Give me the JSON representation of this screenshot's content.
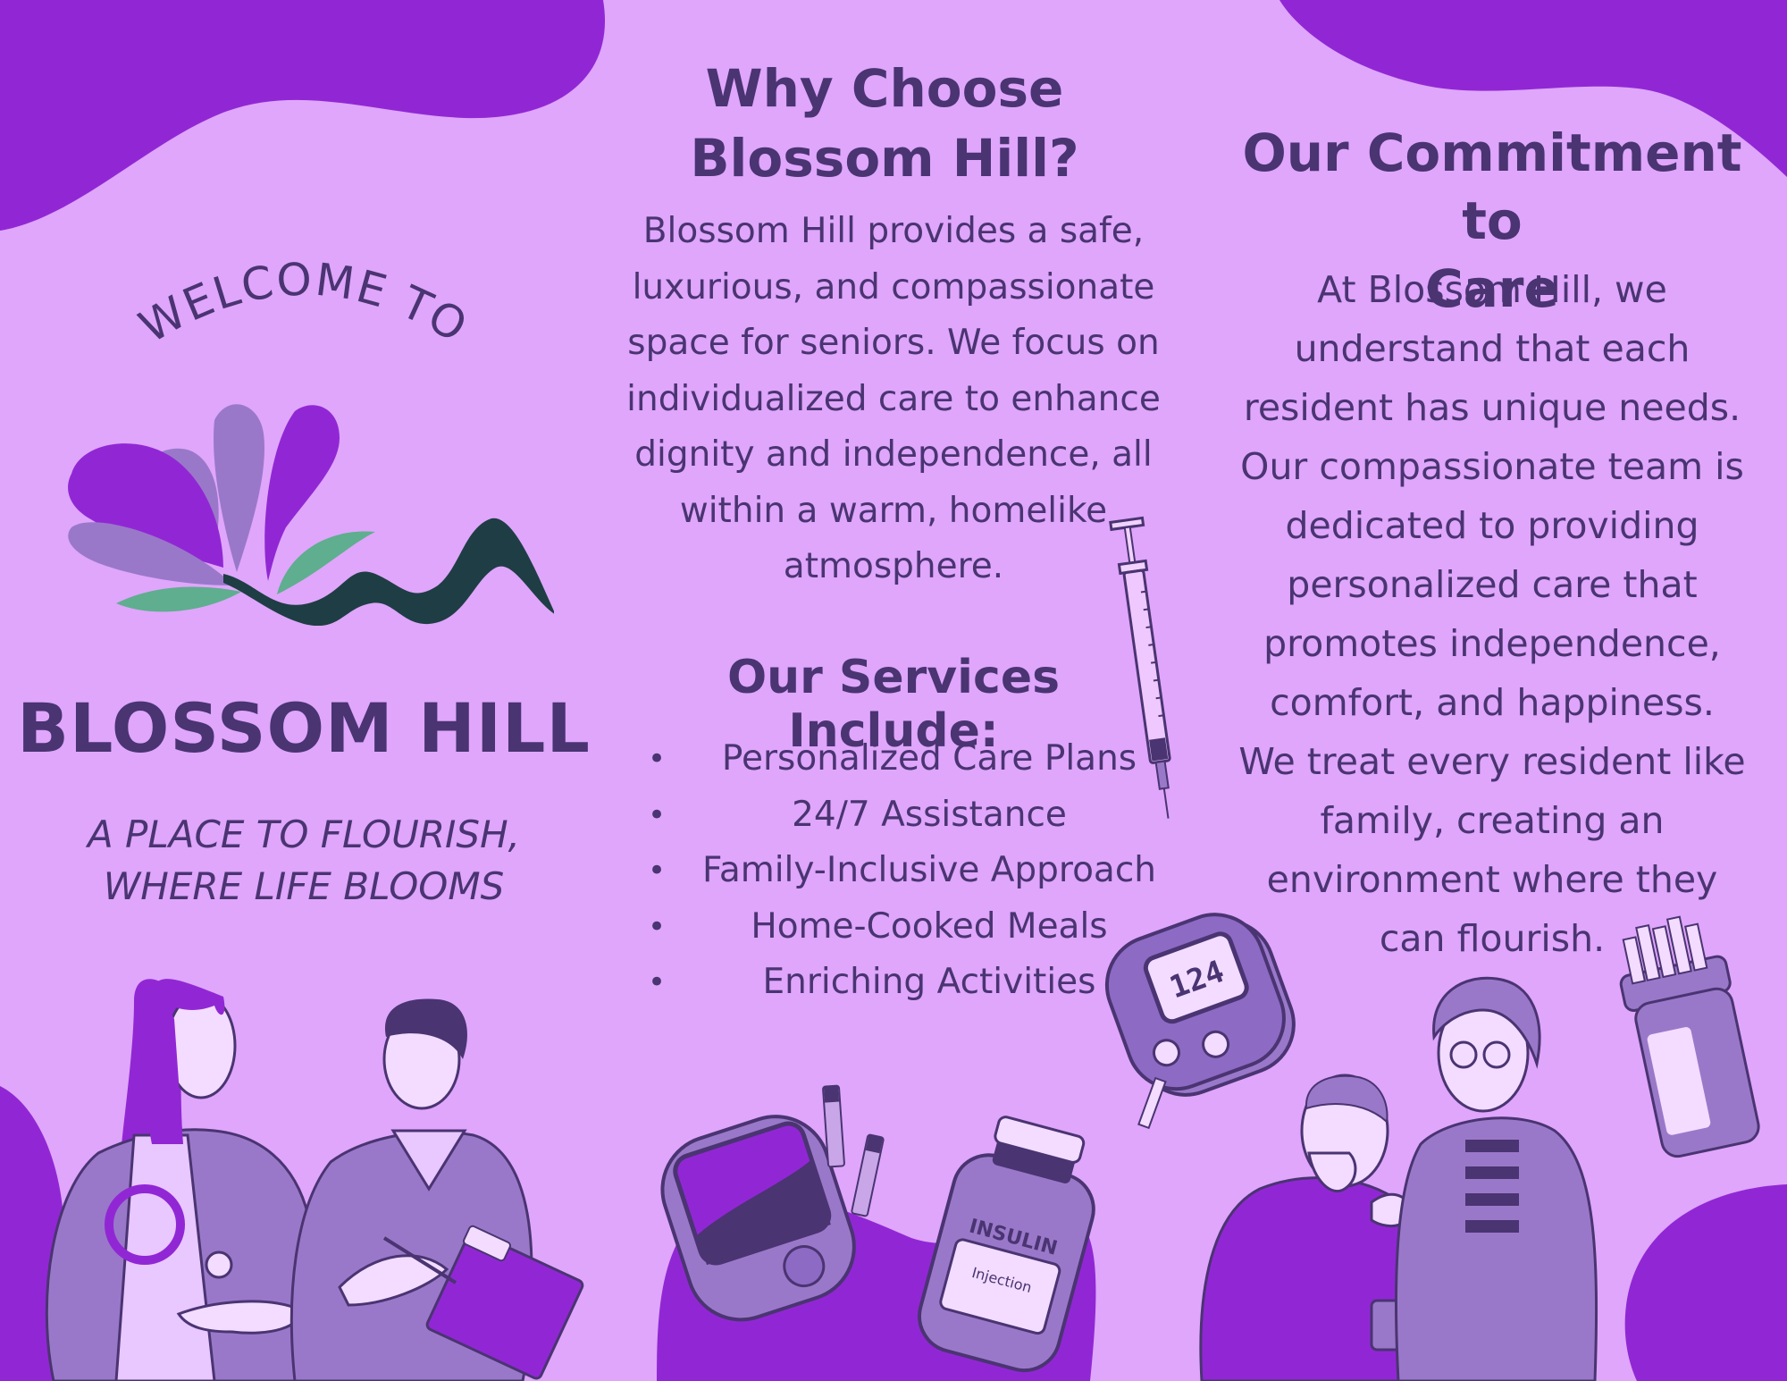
{
  "welcome": "WELCOME TO",
  "brand_name": "BLOSSOM HILL",
  "tagline_line1": "A PLACE TO FLOURISH,",
  "tagline_line2": "WHERE LIFE BLOOMS",
  "why": {
    "title_line1": "Why Choose",
    "title_line2": "Blossom Hill?",
    "body_lines": [
      "Blossom Hill provides a safe,",
      "luxurious, and compassionate",
      "space for seniors. We focus on",
      "individualized care to enhance",
      "dignity and independence, all",
      "within a warm, homelike",
      "atmosphere."
    ]
  },
  "services": {
    "title": "Our Services Include:",
    "bullet": "•",
    "items": [
      "Personalized Care Plans",
      "24/7 Assistance",
      "Family-Inclusive Approach",
      "Home-Cooked Meals",
      "Enriching Activities"
    ]
  },
  "commitment": {
    "title_line1": "Our Commitment to",
    "title_line2": "Care",
    "body_lines": [
      "At Blossom Hill, we",
      "understand that each",
      "resident has unique needs.",
      "Our compassionate team is",
      "dedicated to providing",
      "personalized care that",
      "promotes independence,",
      "comfort, and happiness.",
      "We treat every resident like",
      "family, creating an",
      "environment where they",
      "can flourish."
    ]
  },
  "illustrations": {
    "meter_display": "124",
    "insulin_label": "INSULIN",
    "injection_label": "Injection"
  },
  "colors": {
    "background": "#dfa6fb",
    "blob": "#9127d4",
    "text": "#4a3472",
    "leaf_green": "#5fae8f",
    "mountain_dark": "#1f3d45"
  }
}
